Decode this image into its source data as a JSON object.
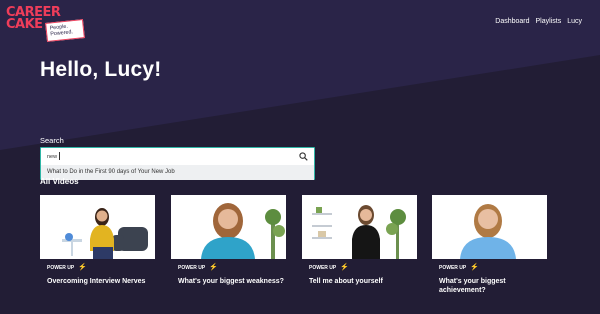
{
  "brand": {
    "line1": "CAREER",
    "line2": "CAKE",
    "tagline1": "People.",
    "tagline2": "Powered."
  },
  "nav": {
    "items": [
      "Dashboard",
      "Playlists",
      "Lucy"
    ]
  },
  "greeting": "Hello, Lucy!",
  "search": {
    "label": "Search",
    "value": "new",
    "suggestion": "What to Do in the First 90 days of Your New Job"
  },
  "all_videos": {
    "title": "All Videos",
    "cards": [
      {
        "tag": "POWER UP",
        "title": "Overcoming Interview Nerves"
      },
      {
        "tag": "POWER UP",
        "title": "What's your biggest weakness?"
      },
      {
        "tag": "POWER UP",
        "title": "Tell me about yourself"
      },
      {
        "tag": "POWER UP",
        "title": "What's your biggest achievement?"
      }
    ]
  },
  "colors": {
    "background": "#221d35",
    "brand_red": "#ef3d5a",
    "search_border": "#2fb6a6"
  },
  "icons": {
    "search": "magnifier-icon",
    "tag": "lightning-bolt-icon"
  }
}
